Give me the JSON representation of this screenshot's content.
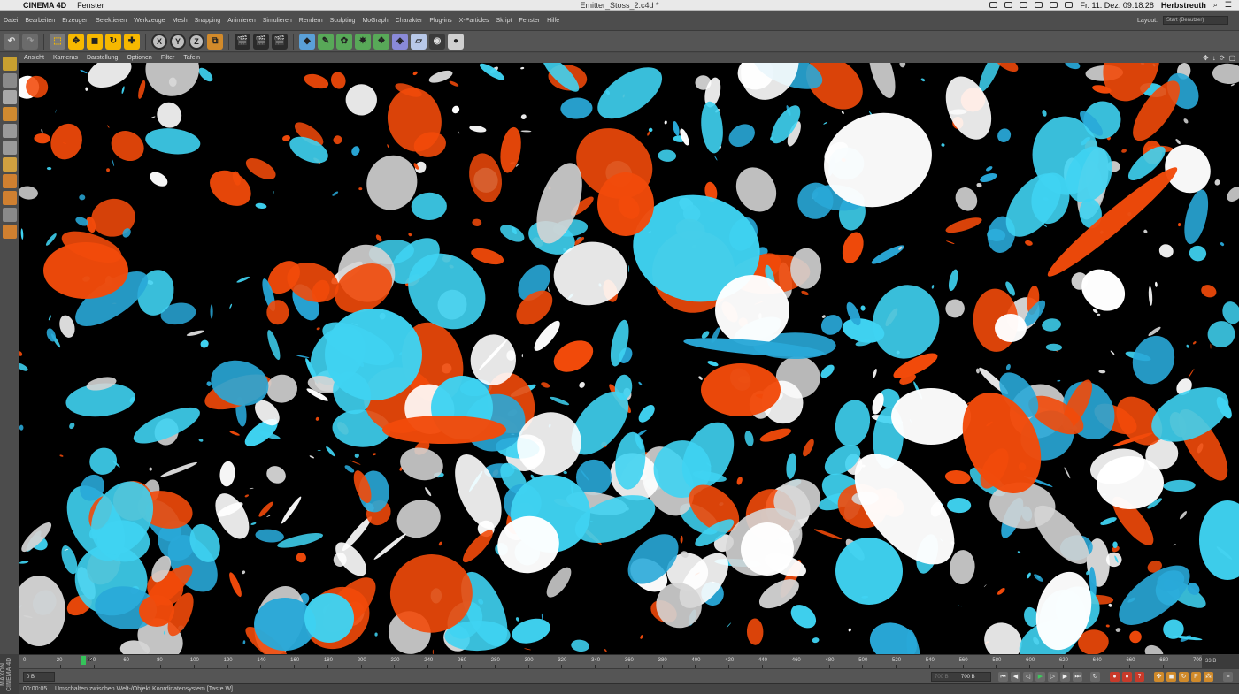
{
  "mac_menubar": {
    "app_name": "CINEMA 4D",
    "menus": [
      "Fenster"
    ],
    "window_title": "Emitter_Stoss_2.c4d *",
    "clock": "Fr. 11. Dez.  09:18:28",
    "user": "Herbstreuth"
  },
  "menubar": {
    "items": [
      "Datei",
      "Bearbeiten",
      "Erzeugen",
      "Selektieren",
      "Werkzeuge",
      "Mesh",
      "Snapping",
      "Animieren",
      "Simulieren",
      "Rendern",
      "Sculpting",
      "MoGraph",
      "Charakter",
      "Plug-ins",
      "X-Particles",
      "Skript",
      "Fenster",
      "Hilfe"
    ],
    "layout_label": "Layout:",
    "layout_value": "Start (Benutzer)"
  },
  "toolbar": {
    "axis_buttons": [
      "X",
      "Y",
      "Z"
    ]
  },
  "viewport_menu": {
    "items": [
      "Ansicht",
      "Kameras",
      "Darstellung",
      "Optionen",
      "Filter",
      "Tafeln"
    ]
  },
  "timeline": {
    "ticks": [
      "0",
      "20",
      "40",
      "60",
      "80",
      "100",
      "120",
      "140",
      "160",
      "180",
      "200",
      "220",
      "240",
      "260",
      "280",
      "300",
      "320",
      "340",
      "360",
      "380",
      "400",
      "420",
      "440",
      "460",
      "480",
      "500",
      "520",
      "540",
      "560",
      "580",
      "600",
      "620",
      "640",
      "660",
      "680",
      "700"
    ],
    "current_frame": "33",
    "end_label": "33 B"
  },
  "transport": {
    "start_field": "0 B",
    "min_field": "700 B",
    "end_field": "700 B"
  },
  "status": {
    "time": "00:00:05",
    "message": "Umschalten zwischen Welt-/Objekt Koordinatensystem [Taste W]"
  },
  "maxon_logo": "MAXON CINEMA 4D",
  "colors": {
    "orange": "#f24a0a",
    "cyan": "#3fd3f2",
    "blue": "#29a8d8",
    "white": "#ffffff",
    "grey": "#d4d4d4",
    "viewport_bg": "#000000"
  }
}
